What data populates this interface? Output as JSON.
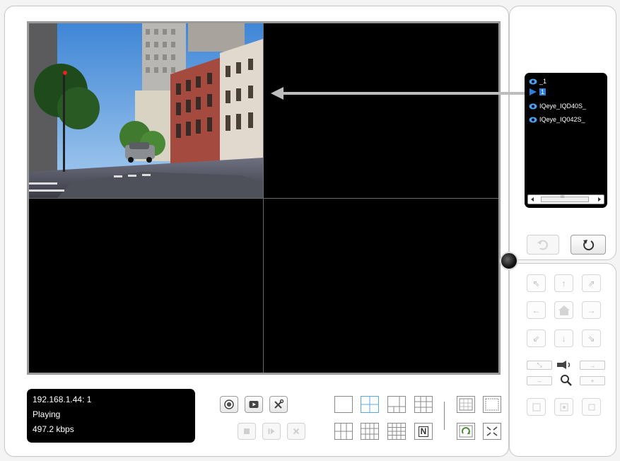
{
  "status": {
    "address": "192.168.1.44: 1",
    "state": "Playing",
    "bitrate": "497.2 kbps"
  },
  "camera_list": {
    "items": [
      {
        "label": "_1",
        "icon": "camera-icon"
      },
      {
        "label": "1",
        "icon": "play-arrow-icon",
        "selected": true
      },
      {
        "label": "IQeye_IQD40S_",
        "icon": "camera-icon"
      },
      {
        "label": "IQeye_IQ042S_",
        "icon": "camera-icon"
      }
    ],
    "scroll_thumb_label": "III"
  },
  "layout_buttons": {
    "n_label": "N"
  },
  "colors": {
    "accent": "#2b7fe0",
    "panel_border": "#c8c8c8",
    "video_bg": "#000000"
  }
}
